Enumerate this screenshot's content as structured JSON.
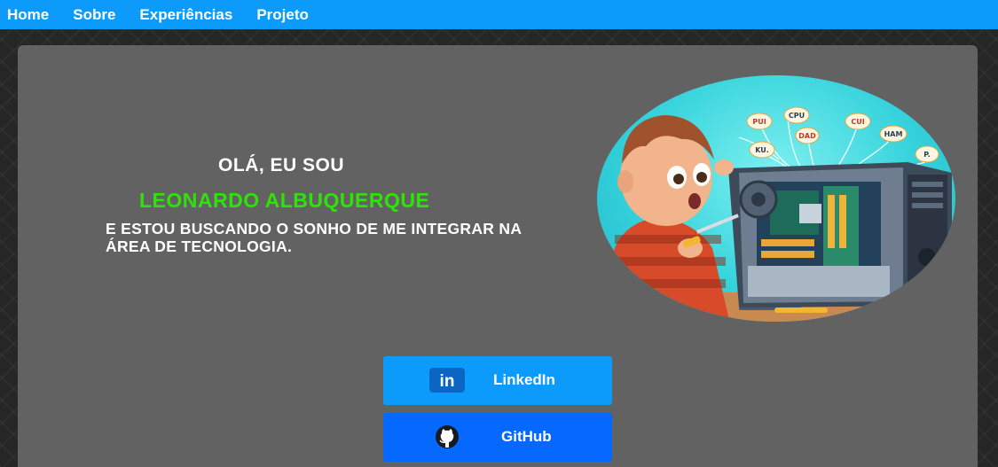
{
  "nav": {
    "items": [
      {
        "label": "Home"
      },
      {
        "label": "Sobre"
      },
      {
        "label": "Experiências"
      },
      {
        "label": "Projeto"
      }
    ]
  },
  "hero": {
    "greeting": "OLÁ, EU SOU",
    "name": "LEONARDO ALBUQUERQUE",
    "tagline": "E ESTOU BUSCANDO O SONHO DE ME INTEGRAR NA ÁREA DE TECNOLOGIA.",
    "illustration": {
      "bubble_labels": [
        "PUI",
        "CPU",
        "DAD",
        "CUI",
        "HAM",
        "KU.",
        "P."
      ]
    }
  },
  "social": {
    "linkedin": {
      "label": "LinkedIn",
      "icon": "linkedin-icon",
      "color": "#0d9bfb"
    },
    "github": {
      "label": "GitHub",
      "icon": "github-icon",
      "color": "#0568ff"
    }
  },
  "colors": {
    "navbar": "#0d9bfb",
    "panel": "#626262",
    "name_accent": "#2fe20a",
    "background": "#262626"
  }
}
